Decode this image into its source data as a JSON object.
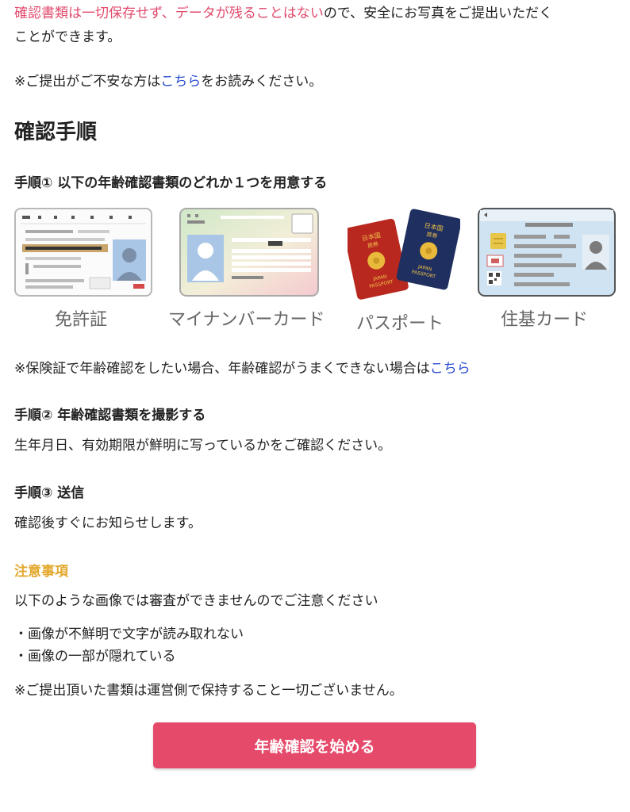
{
  "intro": {
    "pink_text": "確認書類は一切保存せず、データが残ることはない",
    "line1_rest": "ので、安全にお写真をご提出いただく",
    "line2": "ことができます。"
  },
  "notice": {
    "prefix": "※ご提出がご不安な方は",
    "link": "こちら",
    "suffix": "をお読みください。"
  },
  "section_title": "確認手順",
  "step1": {
    "title": "手順① 以下の年齢確認書類のどれか１つを用意する",
    "documents": [
      "免許証",
      "マイナンバーカード",
      "パスポート",
      "住基カード"
    ]
  },
  "insurance_note": {
    "text": "※保険証で年齢確認をしたい場合、年齢確認がうまくできない場合は",
    "link": "こちら"
  },
  "step2": {
    "title": "手順② 年齢確認書類を撮影する",
    "body": "生年月日、有効期限が鮮明に写っているかをご確認ください。"
  },
  "step3": {
    "title": "手順③ 送信",
    "body": "確認後すぐにお知らせします。"
  },
  "caution": {
    "title": "注意事項",
    "body": "以下のような画像では審査ができませんのでご注意ください",
    "items": [
      "・画像が不鮮明で文字が読み取れない",
      "・画像の一部が隠れている"
    ],
    "footer": "※ご提出頂いた書類は運営側で保持すること一切ございません。"
  },
  "passport_text": {
    "country": "日本国",
    "kind": "旅券",
    "en1": "JAPAN",
    "en2": "PASSPORT"
  },
  "cta": {
    "label": "年齢確認を始める"
  },
  "colors": {
    "accent_pink": "#e64a6b",
    "link_blue": "#2a4bd0",
    "caution_yellow": "#e3a82c",
    "passport_red": "#b9281f",
    "passport_navy": "#1f2f5f"
  },
  "icons": [
    "drivers-license-icon",
    "my-number-card-icon",
    "passport-icon",
    "juki-card-icon"
  ]
}
